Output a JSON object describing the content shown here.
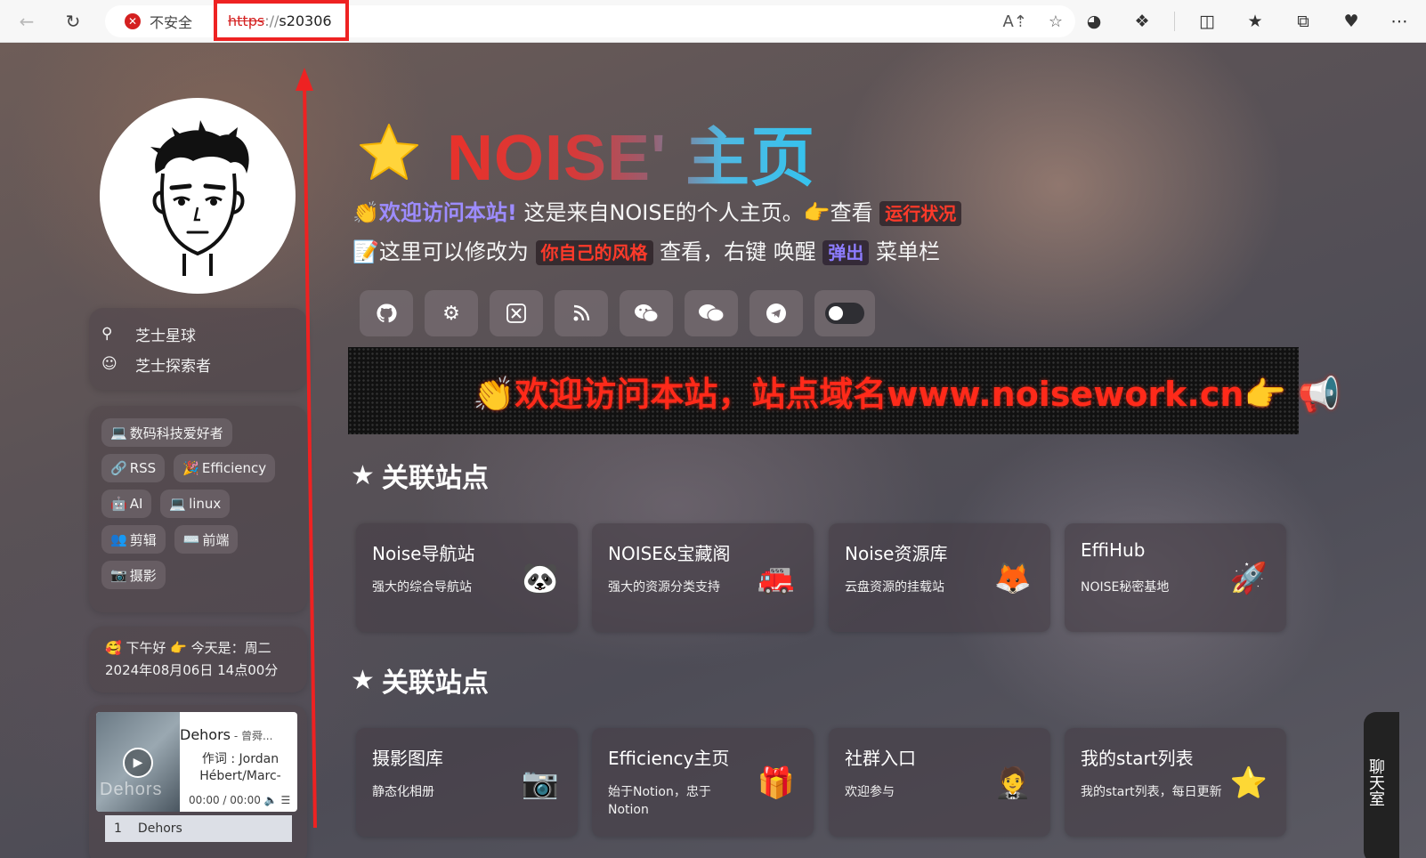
{
  "browser": {
    "security_label": "不安全",
    "url_protocol": "https",
    "url_sep": "://",
    "url_host": "s20306"
  },
  "header": {
    "title": "NOISE' 主页",
    "line1_welcome": "👏欢迎访问本站!",
    "line1_text": " 这是来自NOISE的个人主页。👉查看 ",
    "line1_pill": "运行状况",
    "line2_pre": "📝这里可以修改为 ",
    "line2_pill": "你自己的风格",
    "line2_mid": " 查看，右键 唤醒 ",
    "line2_pill2": "弹出",
    "line2_post": " 菜单栏"
  },
  "profile": {
    "location": "芝士星球",
    "role": "芝士探索者"
  },
  "tags": [
    {
      "emoji": "💻",
      "label": "数码科技爱好者"
    },
    {
      "emoji": "🔗",
      "label": "RSS"
    },
    {
      "emoji": "🎉",
      "label": "Efficiency"
    },
    {
      "emoji": "🤖",
      "label": "AI"
    },
    {
      "emoji": "💻",
      "label": "linux"
    },
    {
      "emoji": "👥",
      "label": "剪辑"
    },
    {
      "emoji": "⌨️",
      "label": "前端"
    },
    {
      "emoji": "📷",
      "label": "摄影"
    }
  ],
  "greeting": {
    "line1": "🥰 下午好 👉 今天是：周二",
    "line2": "2024年08月06日 14点00分"
  },
  "music": {
    "title": "Dehors",
    "artist": " - 曾舜...",
    "lyric": "作词 : Jordan Hébert/Marc-",
    "time": "00:00 / 00:00",
    "cover_text": "Dehors",
    "list_index": "1",
    "list_title": "Dehors"
  },
  "banner": {
    "text": "👏欢迎访问本站，站点域名www.noisework.cn👉 📢"
  },
  "sections": [
    {
      "title": "关联站点",
      "sites": [
        {
          "name": "Noise导航站",
          "desc": "强大的综合导航站",
          "icon": "🐼"
        },
        {
          "name": "NOISE&宝藏阁",
          "desc": "强大的资源分类支持",
          "icon": "🚒"
        },
        {
          "name": "Noise资源库",
          "desc": "云盘资源的挂载站",
          "icon": "🦊"
        },
        {
          "name": "EffiHub",
          "desc": "NOISE秘密基地",
          "icon": "🚀"
        }
      ]
    },
    {
      "title": "关联站点",
      "sites": [
        {
          "name": "摄影图库",
          "desc": "静态化相册",
          "icon": "📷"
        },
        {
          "name": "Efficiency主页",
          "desc": "始于Notion，忠于Notion",
          "icon": "🎁"
        },
        {
          "name": "社群入口",
          "desc": "欢迎参与",
          "icon": "🤵"
        },
        {
          "name": "我的start列表",
          "desc": "我的start列表，每日更新",
          "icon": "⭐"
        }
      ]
    }
  ],
  "chat": {
    "label": "聊天室"
  },
  "colors": {
    "accent_red": "#ff2a1a",
    "accent_blue": "#34c3ee",
    "highlight_border": "#ee2222"
  }
}
